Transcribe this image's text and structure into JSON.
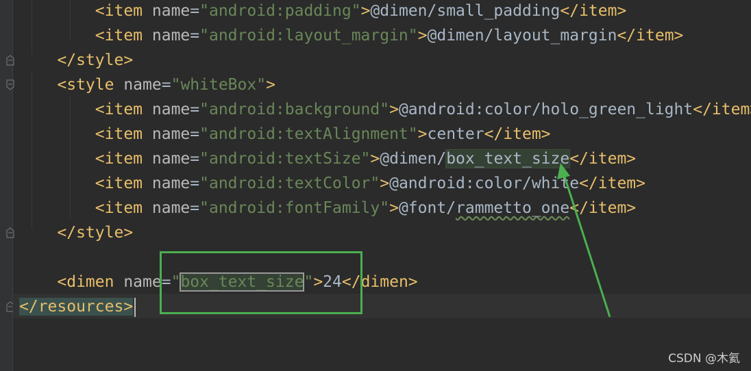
{
  "editor": {
    "lines": [
      {
        "indent": "        ",
        "open": "<item ",
        "attr": "name",
        "eq": "=",
        "q1": "\"",
        "value": "android:padding",
        "q2": "\"",
        "close": ">",
        "text": "@dimen/small_padding",
        "end": "</item>"
      },
      {
        "indent": "        ",
        "open": "<item ",
        "attr": "name",
        "eq": "=",
        "q1": "\"",
        "value": "android:layout_margin",
        "q2": "\"",
        "close": ">",
        "text": "@dimen/layout_margin",
        "end": "</item>"
      },
      {
        "indent": "    ",
        "tagonly": "</style>"
      },
      {
        "indent": "    ",
        "open": "<style ",
        "attr": "name",
        "eq": "=",
        "q1": "\"",
        "value": "whiteBox",
        "q2": "\"",
        "close": ">"
      },
      {
        "indent": "        ",
        "open": "<item ",
        "attr": "name",
        "eq": "=",
        "q1": "\"",
        "value": "android:background",
        "q2": "\"",
        "close": ">",
        "text": "@android:color/holo_green_light",
        "end": "</item>"
      },
      {
        "indent": "        ",
        "open": "<item ",
        "attr": "name",
        "eq": "=",
        "q1": "\"",
        "value": "android:textAlignment",
        "q2": "\"",
        "close": ">",
        "text": "center",
        "end": "</item>"
      },
      {
        "indent": "        ",
        "open": "<item ",
        "attr": "name",
        "eq": "=",
        "q1": "\"",
        "value": "android:textSize",
        "q2": "\"",
        "close": ">",
        "text_pre": "@dimen/",
        "text_hl": "box_text_size",
        "end": "</item>"
      },
      {
        "indent": "        ",
        "open": "<item ",
        "attr": "name",
        "eq": "=",
        "q1": "\"",
        "value": "android:textColor",
        "q2": "\"",
        "close": ">",
        "text": "@android:color/white",
        "end": "</item>"
      },
      {
        "indent": "        ",
        "open": "<item ",
        "attr": "name",
        "eq": "=",
        "q1": "\"",
        "value": "android:fontFamily",
        "q2": "\"",
        "close": ">",
        "text_pre": "@font/",
        "text_sq": "rammetto_one",
        "end": "</item>"
      },
      {
        "indent": "    ",
        "tagonly": "</style>"
      },
      {
        "indent": "",
        "tagonly": ""
      },
      {
        "indent": "    ",
        "open": "<dimen ",
        "attr": "name",
        "eq": "=",
        "q1": "\"",
        "value_hl": "box_text_size",
        "q2": "\"",
        "close": ">",
        "text": "24",
        "end": "</dimen>"
      },
      {
        "indent": "",
        "tagonly": "</resources>",
        "caret": true
      }
    ]
  },
  "watermark": "CSDN @木氦",
  "colors": {
    "annotation": "#4caf50"
  }
}
